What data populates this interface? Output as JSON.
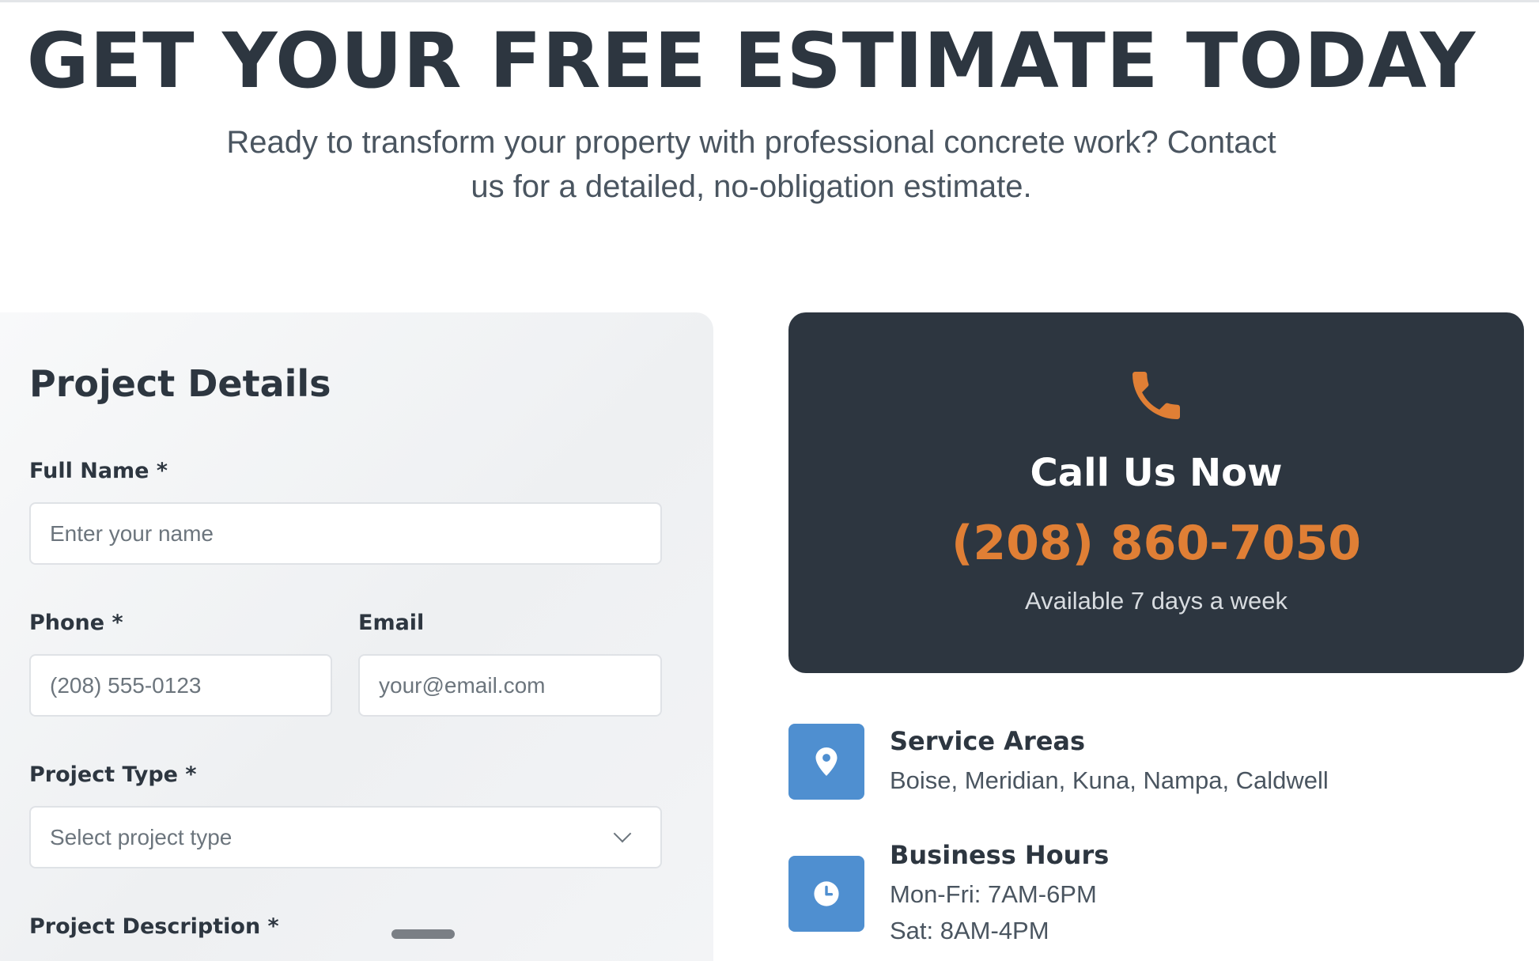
{
  "header": {
    "headline": "GET YOUR FREE ESTIMATE TODAY",
    "subtitle": "Ready to transform your property with professional concrete work? Contact us for a detailed, no-obligation estimate."
  },
  "form": {
    "title": "Project Details",
    "full_name": {
      "label": "Full Name *",
      "placeholder": "Enter your name",
      "value": ""
    },
    "phone": {
      "label": "Phone *",
      "placeholder": "(208) 555-0123",
      "value": ""
    },
    "email": {
      "label": "Email",
      "placeholder": "your@email.com",
      "value": ""
    },
    "project_type": {
      "label": "Project Type *",
      "selected": "Select project type"
    },
    "project_description": {
      "label": "Project Description *"
    }
  },
  "call_card": {
    "icon": "phone-icon",
    "title": "Call Us Now",
    "phone_number": "(208) 860-7050",
    "availability": "Available 7 days a week"
  },
  "info": {
    "service_areas": {
      "icon": "map-pin-icon",
      "title": "Service Areas",
      "text": "Boise, Meridian, Kuna, Nampa, Caldwell"
    },
    "business_hours": {
      "icon": "clock-icon",
      "title": "Business Hours",
      "weekday": "Mon-Fri: 7AM-6PM",
      "saturday": "Sat: 8AM-4PM"
    }
  },
  "colors": {
    "dark": "#2d3640",
    "accent_orange": "#e07f35",
    "icon_blue": "#4f8fd0",
    "form_bg": "#f1f3f5"
  }
}
